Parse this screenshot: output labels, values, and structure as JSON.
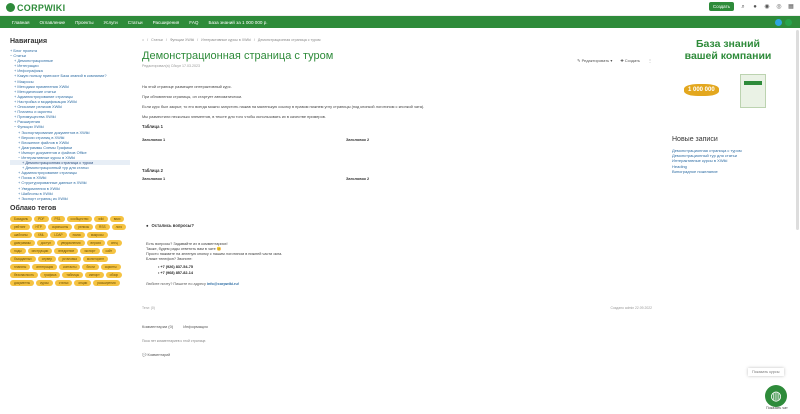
{
  "header": {
    "logo_text": "CORPWIKI",
    "create_label": "Создать",
    "icons": [
      "search-icon",
      "bell-icon",
      "user-icon",
      "globe-icon",
      "grid-icon"
    ]
  },
  "nav": {
    "items": [
      "Главная",
      "Оглавление",
      "Проекты",
      "Услуги",
      "Статьи",
      "Расширения",
      "FAQ",
      "База знаний за 1 000 000 р."
    ]
  },
  "social": {
    "colors": [
      "#2ca5e0",
      "#27a34b"
    ]
  },
  "sidebar": {
    "title": "Навигация",
    "tree": [
      "+ Блог проекта",
      "− Статьи",
      "+ Демонстрационные",
      "+ Интеграции",
      "+ Инфографика",
      "+ Какую пользу приносит База знаний в компании?",
      "+ Макросы",
      "+ Методики применения XWiki",
      "+ Методические статьи",
      "+ Администрирование страницы",
      "+ Настройка и модификация XWiki",
      "+ Описание релизов XWiki",
      "+ Плагины и скрипты",
      "+ Преимущества XWiki",
      "+ Расширения",
      "− Функции XWiki",
      "+ Экспортирование документов в XWiki",
      "+ Версии страниц в XWiki",
      "+ Вложение файлов в XWiki",
      "+ Диаграммы Схемы Графики",
      "+ Импорт документов и файлов Office",
      "− Интерактивные курсы в XWiki",
      "+ Демонстрационная страница с туром",
      "+ Демонстрационный тур для статьи",
      "+ Администрирование страницы",
      "+ Поиск в XWiki",
      "+ Структурированные данные в XWiki",
      "+ Уведомления в XWiki",
      "+ Шаблоны в XWiki",
      "+ Экспорт страниц из XWiki"
    ],
    "selected_index": 22,
    "tags_title": "Облако тегов",
    "tags": [
      "Базадань",
      "PDF",
      "PS1",
      "сообщество",
      "wiki",
      "вики",
      "рейтинг",
      "HTP",
      "скриншоты",
      "релизы",
      "RSS",
      "лого",
      "шаблоны",
      "XML",
      "LDAP",
      "поиск",
      "макросы",
      "диаграммы",
      "доступ",
      "уведомления",
      "версия",
      "спец",
      "ноды",
      "инструкции",
      "внедрение",
      "экспорт",
      "сайт",
      "базаданных",
      "сервер",
      "установка",
      "мониторинг",
      "плагины",
      "интеграция",
      "контакты",
      "блоги",
      "скрипты",
      "безопасность",
      "графика",
      "таблицы",
      "импорт",
      "обзор",
      "документы",
      "курсы",
      "статьи",
      "опции",
      "расширения"
    ]
  },
  "main": {
    "breadcrumbs": [
      "Статьи",
      "Функции XWiki",
      "Интерактивные курсы в XWiki",
      "Демонстрационная страница с туром"
    ],
    "title": "Демонстрационная страница с туром",
    "meta": "Редактировал(а) Сйсун 17.03.2023",
    "edit_label": "Редактировать",
    "create_label": "Создать",
    "paragraphs": [
      "На этой странице размещен интерактивный курс.",
      "При обновлении страницы, он стартует автоматически.",
      "Если курс был закрыт, то его всегда можно запустить нажав на маленькую ссылку в правом нижнем углу страницы (под кнопкой логотипом с кнопкой чата).",
      "Мы разместили несколько элементов, в тексте для того чтобы использовать их в качестве примеров."
    ],
    "table1_caption": "Таблица 1",
    "table2_caption": "Таблица 2",
    "col1": "Заголовок 1",
    "col2": "Заголовок 2",
    "questions_title": "Остались вопросы?",
    "q_lines": [
      "Есть вопросы? Задавайте их в комментариях!",
      "Также, будем рады ответить вам в чате 😊",
      "Просто нажмите на зеленую кнопку с нашим логотипом в нижней части окна.",
      "Ближе телефон? Звоните:"
    ],
    "phones": [
      "+7 (926) 837-54-75",
      "+7 (968) 857-82-14"
    ],
    "mail_prefix": "Любите почту? Пишите по адресу",
    "mail": "info@corpwiki.ru!",
    "tags_label": "Теги: (0)",
    "created": "Создано admin 22.09.2022",
    "tab_comments": "Комментарии (0)",
    "tab_info": "Информация",
    "no_comments": "Пока нет комментариев к этой странице.",
    "add_comment": "Комментарий"
  },
  "right": {
    "banner_title": "База знаний вашей компании",
    "banner_price": "1 000 000",
    "news_title": "Новые записи",
    "news": [
      "Демонстрационная страница с туром",
      "Демонстрационный тур для статьи",
      "Интерактивные курсы в XWiki",
      "Heading",
      "Виноградное пожелание"
    ]
  },
  "toast": "Показать курсы",
  "fab_label": "Показать чат",
  "colors": {
    "accent": "#2e8b3a",
    "link": "#2e6da4",
    "tag": "#f5c342"
  }
}
